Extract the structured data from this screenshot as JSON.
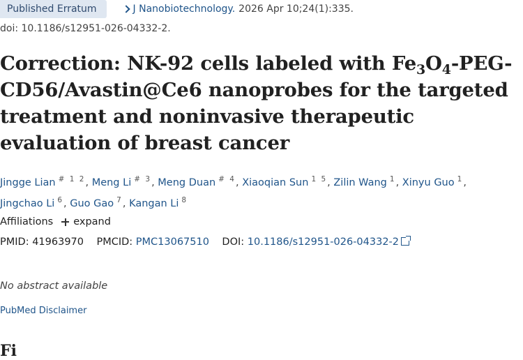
{
  "badge": "Published Erratum",
  "journal": "J Nanobiotechnology.",
  "citation": "2026 Apr 10;24(1):335.",
  "doi_line": "doi: 10.1186/s12951-026-04332-2.",
  "title": {
    "pre": "Correction: NK-92 cells labeled with Fe",
    "sub1": "3",
    "mid": "O",
    "sub2": "4",
    "post": "-PEG-CD56/Avastin@Ce6 nanoprobes for the targeted treatment and noninvasive therapeutic evaluation of breast cancer"
  },
  "authors": [
    {
      "name": "Jingge Lian",
      "sup": "# 1 2"
    },
    {
      "name": "Meng Li",
      "sup": "# 3"
    },
    {
      "name": "Meng Duan",
      "sup": "# 4"
    },
    {
      "name": "Xiaoqian Sun",
      "sup": "1 5"
    },
    {
      "name": "Zilin Wang",
      "sup": "1"
    },
    {
      "name": "Xinyu Guo",
      "sup": "1"
    },
    {
      "name": "Jingchao Li",
      "sup": "6"
    },
    {
      "name": "Guo Gao",
      "sup": "7"
    },
    {
      "name": "Kangan Li",
      "sup": "8"
    }
  ],
  "affiliations": {
    "label": "Affiliations",
    "expand": "expand"
  },
  "ids": {
    "pmid_label": "PMID:",
    "pmid": "41963970",
    "pmcid_label": "PMCID:",
    "pmcid": "PMC13067510",
    "doi_label": "DOI:",
    "doi": "10.1186/s12951-026-04332-2"
  },
  "no_abstract": "No abstract available",
  "disclaimer": "PubMed Disclaimer",
  "cutoff_heading": "Fi"
}
